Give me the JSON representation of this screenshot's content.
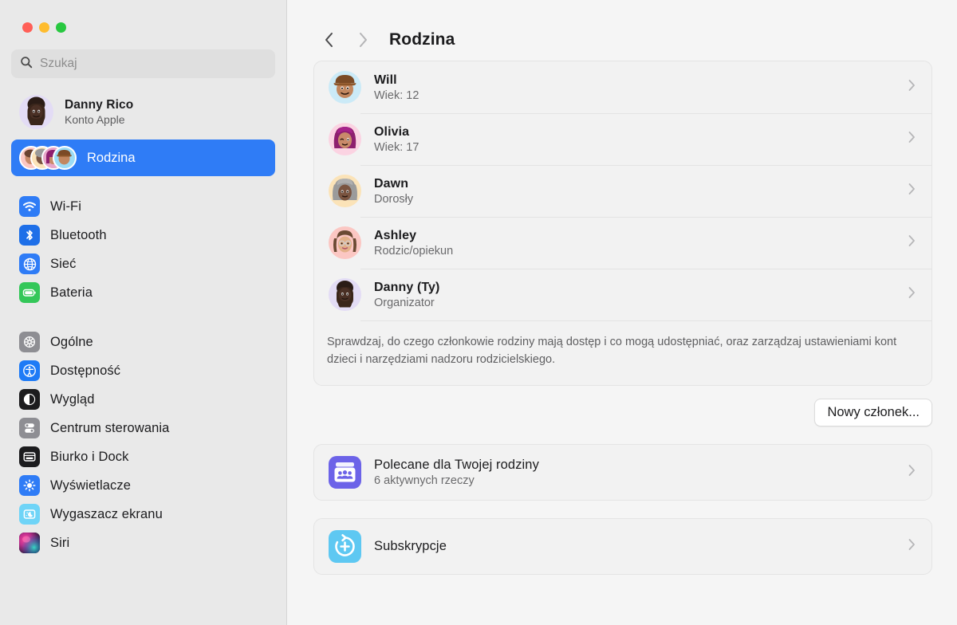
{
  "window": {
    "traffic_lights": [
      {
        "name": "close",
        "color": "#FF5F57"
      },
      {
        "name": "minimize",
        "color": "#FEBC2E"
      },
      {
        "name": "zoom",
        "color": "#28C840"
      }
    ]
  },
  "sidebar": {
    "search": {
      "placeholder": "Szukaj",
      "value": ""
    },
    "account": {
      "name": "Danny Rico",
      "subtitle": "Konto Apple",
      "avatar_bg": "#E3DCF5"
    },
    "family_item": {
      "label": "Rodzina",
      "selected": true,
      "accent": "#2F7CF6"
    },
    "groups": [
      {
        "items": [
          {
            "label": "Wi-Fi",
            "icon": "wifi-icon",
            "icon_bg": "#2F7CF6"
          },
          {
            "label": "Bluetooth",
            "icon": "bluetooth-icon",
            "icon_bg": "#1E6FE8"
          },
          {
            "label": "Sieć",
            "icon": "globe-icon",
            "icon_bg": "#2F7CF6"
          },
          {
            "label": "Bateria",
            "icon": "battery-icon",
            "icon_bg": "#34C759"
          }
        ]
      },
      {
        "items": [
          {
            "label": "Ogólne",
            "icon": "gear-icon",
            "icon_bg": "#8E8E93"
          },
          {
            "label": "Dostępność",
            "icon": "accessibility-icon",
            "icon_bg": "#1E7BF6"
          },
          {
            "label": "Wygląd",
            "icon": "appearance-icon",
            "icon_bg": "#1C1C1E"
          },
          {
            "label": "Centrum sterowania",
            "icon": "control-center-icon",
            "icon_bg": "#8E8E93"
          },
          {
            "label": "Biurko i Dock",
            "icon": "desktop-dock-icon",
            "icon_bg": "#1C1C1E"
          },
          {
            "label": "Wyświetlacze",
            "icon": "display-brightness-icon",
            "icon_bg": "#2F7CF6"
          },
          {
            "label": "Wygaszacz ekranu",
            "icon": "screensaver-icon",
            "icon_bg": "#6FD4F7"
          },
          {
            "label": "Siri",
            "icon": "siri-icon",
            "icon_bg": "#2C2B42"
          }
        ]
      }
    ]
  },
  "main": {
    "nav": {
      "back": "‹",
      "forward": "›"
    },
    "title": "Rodzina",
    "members": [
      {
        "name": "Will",
        "subtitle": "Wiek: 12",
        "avatar_bg": "#CBEAF7"
      },
      {
        "name": "Olivia",
        "subtitle": "Wiek: 17",
        "avatar_bg": "#FBD3E2"
      },
      {
        "name": "Dawn",
        "subtitle": "Dorosły",
        "avatar_bg": "#FBE3B8"
      },
      {
        "name": "Ashley",
        "subtitle": "Rodzic/opiekun",
        "avatar_bg": "#FBC7C3"
      },
      {
        "name": "Danny (Ty)",
        "subtitle": "Organizator",
        "avatar_bg": "#E3DCF5"
      }
    ],
    "description": "Sprawdzaj, do czego członkowie rodziny mają dostęp i co mogą udostępniać, oraz zarządzaj ustawieniami kont dzieci i narzędziami nadzoru rodzicielskiego.",
    "new_member_button": "Nowy członek...",
    "sections": [
      {
        "name": "Polecane dla Twojej rodziny",
        "subtitle": "6 aktywnych rzeczy",
        "icon": "family-recommend-icon",
        "icon_bg": "#6C63E8"
      },
      {
        "name": "Subskrypcje",
        "subtitle": "",
        "icon": "subscriptions-icon",
        "icon_bg": "#5EC8F2"
      }
    ]
  }
}
